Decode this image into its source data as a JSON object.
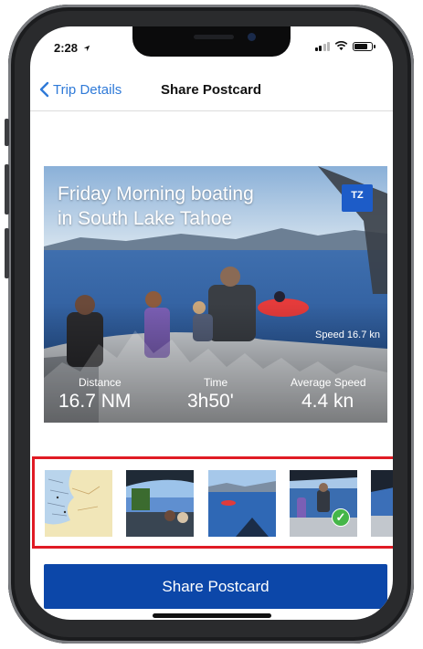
{
  "status": {
    "time": "2:28"
  },
  "nav": {
    "back_label": "Trip Details",
    "title": "Share Postcard"
  },
  "postcard": {
    "title_line1": "Friday Morning boating",
    "title_line2": "in South Lake Tahoe",
    "badge": "TZ",
    "speed_label": "Speed 16.7 kn",
    "stats": [
      {
        "label": "Distance",
        "value": "16.7 NM"
      },
      {
        "label": "Time",
        "value": "3h50'"
      },
      {
        "label": "Average Speed",
        "value": "4.4 kn"
      }
    ]
  },
  "thumbnails": [
    {
      "kind": "map",
      "selected": false
    },
    {
      "kind": "photo",
      "selected": false
    },
    {
      "kind": "photo",
      "selected": false
    },
    {
      "kind": "photo",
      "selected": true
    },
    {
      "kind": "photo",
      "selected": false
    }
  ],
  "share_button": {
    "label": "Share Postcard"
  },
  "colors": {
    "accent": "#0c47a9",
    "link": "#2f7ad8",
    "highlight": "#e01b24",
    "check": "#45b649"
  },
  "icons": {
    "back": "chevron-left-icon",
    "location": "location-arrow-icon",
    "signal": "signal-icon",
    "wifi": "wifi-icon",
    "battery": "battery-icon",
    "checkmark": "checkmark-icon"
  }
}
